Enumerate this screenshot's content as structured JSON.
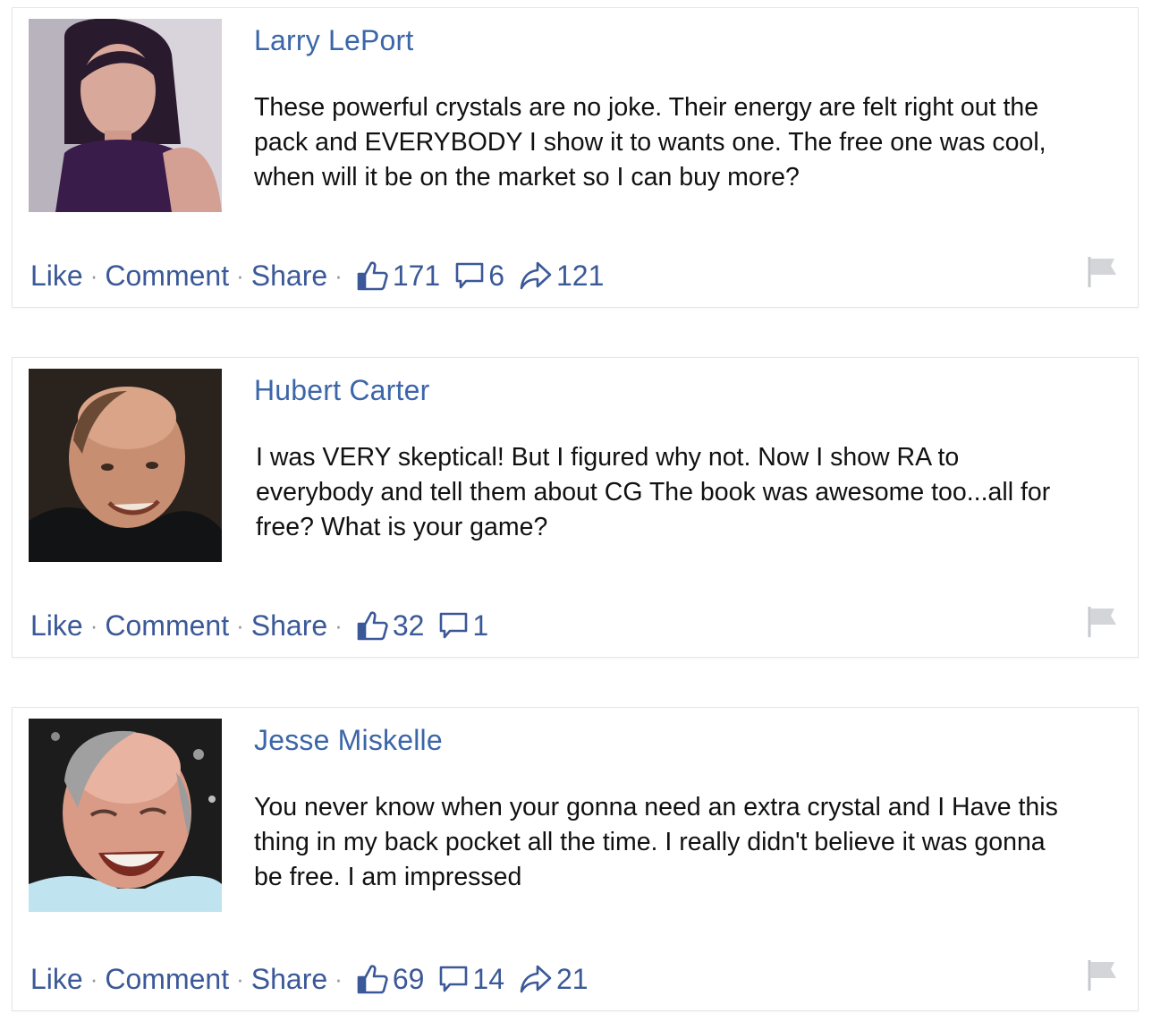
{
  "comments": [
    {
      "author": "Larry LePort",
      "text": "These powerful crystals are no joke. Their energy are felt right out the pack and EVERYBODY I show it to wants one. The free one was cool, when will it be on the market so I can buy more?",
      "actions": {
        "like": "Like",
        "comment": "Comment",
        "share": "Share",
        "separator": "·"
      },
      "counts": {
        "likes": "171",
        "comments": "6",
        "shares": "121"
      }
    },
    {
      "author": "Hubert Carter",
      "text": "I was VERY skeptical! But I figured why not. Now I show RA to everybody and tell them about CG The book was awesome too...all for free? What is your game?",
      "actions": {
        "like": "Like",
        "comment": "Comment",
        "share": "Share",
        "separator": "·"
      },
      "counts": {
        "likes": "32",
        "comments": "1"
      }
    },
    {
      "author": "Jesse Miskelle",
      "text": "You never know when your gonna need an extra crystal and I Have this thing in my back pocket all the time. I really didn't believe it was gonna be free. I am impressed",
      "actions": {
        "like": "Like",
        "comment": "Comment",
        "share": "Share",
        "separator": "·"
      },
      "counts": {
        "likes": "69",
        "comments": "14",
        "shares": "21"
      }
    }
  ],
  "icons": {
    "like": "thumbs-up-icon",
    "comment": "speech-bubble-icon",
    "share": "share-arrow-icon",
    "report": "flag-icon"
  },
  "colors": {
    "author_link": "#3b66a8",
    "action_link": "#3b5998",
    "body_text": "#111111",
    "separator": "#90949c",
    "card_border": "#e4e6eb"
  }
}
